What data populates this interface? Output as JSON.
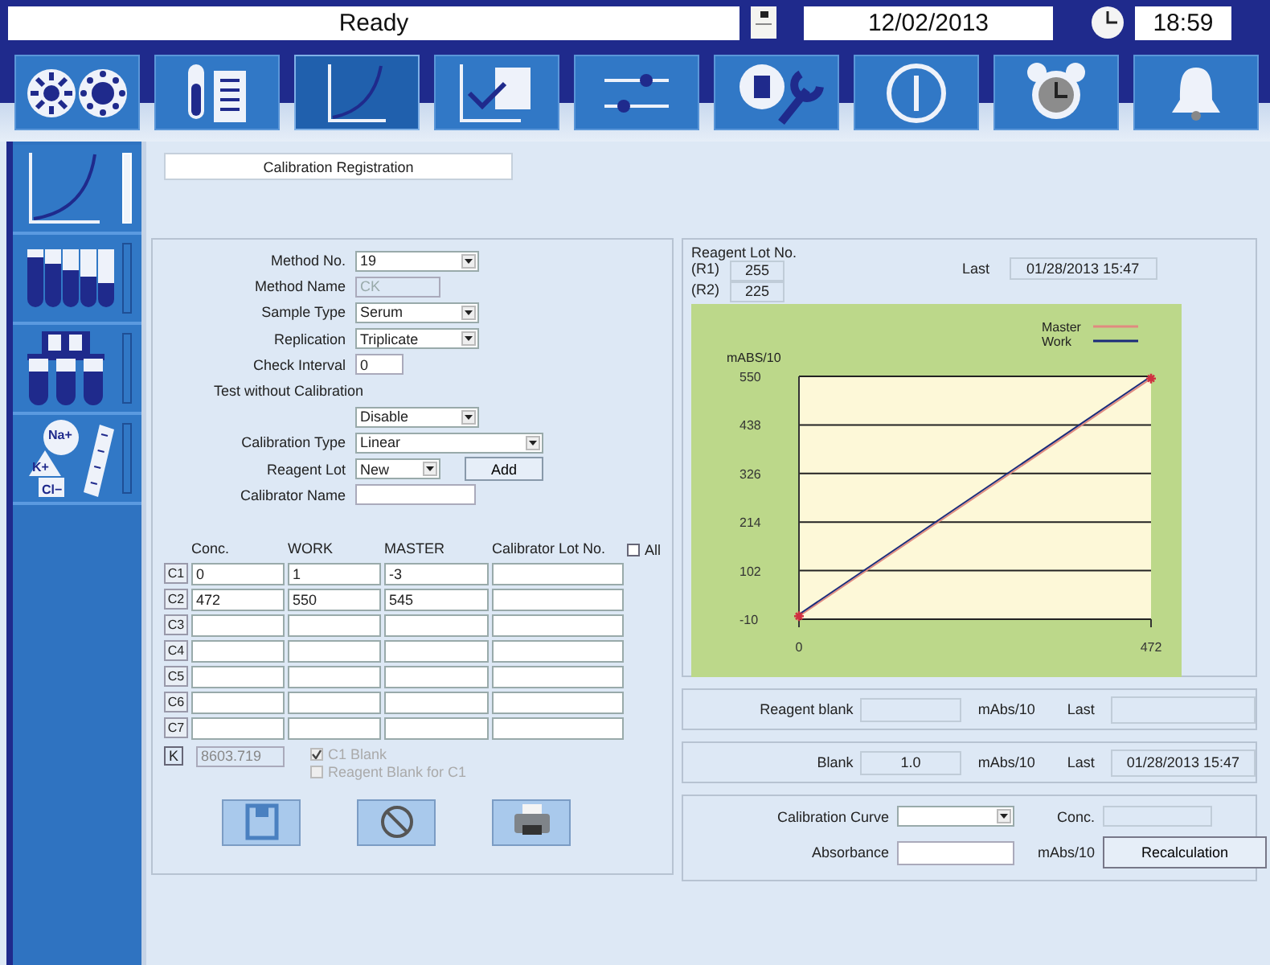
{
  "status_bar": {
    "status": "Ready",
    "date": "12/02/2013",
    "time": "18:59"
  },
  "tabs": [
    {
      "kind": "carousel",
      "selected": false
    },
    {
      "kind": "tube-list",
      "selected": false
    },
    {
      "kind": "curve",
      "selected": true
    },
    {
      "kind": "chart-check",
      "selected": false
    },
    {
      "kind": "sliders",
      "selected": false
    },
    {
      "kind": "tools",
      "selected": false
    },
    {
      "kind": "power",
      "selected": false
    },
    {
      "kind": "alarm",
      "selected": false
    },
    {
      "kind": "bell",
      "selected": false
    }
  ],
  "sidebar": {
    "items": [
      {
        "kind": "curve",
        "selected": true
      },
      {
        "kind": "tubes",
        "selected": false
      },
      {
        "kind": "rack",
        "selected": false
      },
      {
        "kind": "ions",
        "selected": false,
        "labels": [
          "Na+",
          "K+",
          "Cl−"
        ]
      }
    ]
  },
  "page_title": "Calibration Registration",
  "form": [
    {
      "kind": "select",
      "label": "Method No.",
      "value": "19"
    },
    {
      "kind": "readonly",
      "label": "Method Name",
      "value": "CK"
    },
    {
      "kind": "select",
      "label": "Sample Type",
      "value": "Serum"
    },
    {
      "kind": "select",
      "label": "Replication",
      "value": "Triplicate"
    },
    {
      "kind": "input",
      "label": "Check Interval",
      "value": "0"
    },
    {
      "kind": "heading",
      "label": "Test without Calibration"
    },
    {
      "kind": "select",
      "value": "Disable"
    },
    {
      "kind": "select-wide",
      "label": "Calibration Type",
      "value": "Linear"
    },
    {
      "kind": "select-add",
      "label": "Reagent Lot",
      "value": "New",
      "button": "Add"
    },
    {
      "kind": "input-wide",
      "label": "Calibrator Name"
    }
  ],
  "calibrators": {
    "columns": [
      "Conc.",
      "WORK",
      "MASTER",
      "Calibrator Lot No."
    ],
    "all": {
      "label": "All",
      "checked": false
    },
    "rows": [
      {
        "label": "C1",
        "cells": [
          "0",
          "1",
          "-3"
        ]
      },
      {
        "label": "C2",
        "cells": [
          "472",
          "550",
          "545"
        ]
      },
      {
        "label": "C3",
        "cells": []
      },
      {
        "label": "C4",
        "cells": []
      },
      {
        "label": "C5",
        "cells": []
      },
      {
        "label": "C6",
        "cells": []
      },
      {
        "label": "C7",
        "cells": []
      }
    ]
  },
  "factor": {
    "label": "K",
    "value": "8603.719"
  },
  "options": [
    {
      "label": "C1 Blank",
      "checked": true,
      "disabled": true
    },
    {
      "label": "Reagent Blank for C1",
      "checked": false,
      "disabled": true
    }
  ],
  "actions": [
    {
      "kind": "save"
    },
    {
      "kind": "cancel"
    },
    {
      "kind": "print"
    }
  ],
  "reagent_lot": {
    "title": "Reagent Lot No.",
    "lots": [
      {
        "label": "(R1)",
        "value": "255"
      },
      {
        "label": "(R2)",
        "value": "225"
      }
    ],
    "last_label": "Last",
    "last_value": "01/28/2013 15:47"
  },
  "chart": {
    "chart_data": {
      "type": "line",
      "ylabel": "mABS/10",
      "x": [
        0,
        472
      ],
      "xticks": [
        {
          "value": 0,
          "label": "0"
        },
        {
          "value": 472,
          "label": "472"
        }
      ],
      "xlim": [
        0,
        472
      ],
      "ylim": [
        -10,
        550
      ],
      "grid": true,
      "legend": "top right",
      "yticks": [
        {
          "value": -10,
          "label": "-10"
        },
        {
          "value": 102,
          "label": "102"
        },
        {
          "value": 214,
          "label": "214"
        },
        {
          "value": 326,
          "label": "326"
        },
        {
          "value": 438,
          "label": "438"
        },
        {
          "value": 550,
          "label": "550"
        }
      ],
      "series": [
        {
          "name": "Master",
          "color": "#e08a80",
          "marker": "cross",
          "values": [
            -3,
            545
          ]
        },
        {
          "name": "Work",
          "color": "#1a2a7a",
          "values": [
            1,
            550
          ]
        }
      ]
    }
  },
  "reagent_blank": {
    "label": "Reagent blank",
    "unit": "mAbs/10",
    "last_label": "Last"
  },
  "blank": {
    "label": "Blank",
    "value": "1.0",
    "unit": "mAbs/10",
    "last_label": "Last",
    "last_value": "01/28/2013 15:47"
  },
  "recalc": {
    "curve_label": "Calibration Curve",
    "conc_label": "Conc.",
    "absorbance_label": "Absorbance",
    "unit": "mAbs/10",
    "button": "Recalculation"
  }
}
